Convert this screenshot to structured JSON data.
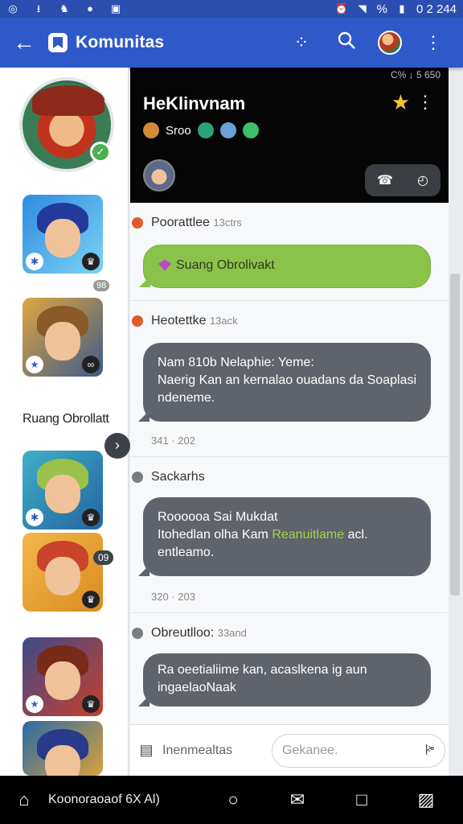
{
  "status_bar": {
    "battery_text": "%",
    "clock": "0 2 244"
  },
  "app_bar": {
    "title": "Komunitas",
    "back_label": "←",
    "more_label": "⋮"
  },
  "sidebar": {
    "online_badge": "✓",
    "count_badge": "98",
    "group_label": "Ruang Obrollatt",
    "arrow_label": "›",
    "pill_label": "09"
  },
  "hero": {
    "corner_text": "C% ↓ 5 650",
    "name": "HeKlinvnam",
    "status": "Sroo",
    "star": "★",
    "kebab": "⋮"
  },
  "feed": [
    {
      "author": "Poorattlee",
      "time": "13ctrs",
      "bubble_text": "Suang Obrolivakt"
    },
    {
      "author": "Heotettke",
      "time": "13ack",
      "line1": "Nam 810b Nelaphie: Yeme:",
      "line2": "Naerig Kan an kernalao ouadans da Soaplasi ndeneme.",
      "stamp": "341 · 202"
    },
    {
      "author": "Sackarhs",
      "time": "",
      "line1": "Roooooa Sai Mukdat",
      "line2_a": "Itohedlan olha Kam",
      "line2_hl": "Reanuitlame",
      "line2_b": "acl. entleamo.",
      "stamp": "320 · 203"
    },
    {
      "author": "Obreutlloo:",
      "time": "33and",
      "line1": "Ra oeetialiime kan, acaslkena ig aun",
      "line2": "ingaelaoNaak"
    }
  ],
  "composer": {
    "draft_label": "Inenmealtas",
    "placeholder": "Gekanee."
  },
  "nav": {
    "text": "Koonoraoaof 6X Al)"
  },
  "colors": {
    "primary": "#2f59c8",
    "bubble": "#5f636b",
    "green_bubble": "#8bc34a",
    "accent_star": "#f4c430"
  }
}
